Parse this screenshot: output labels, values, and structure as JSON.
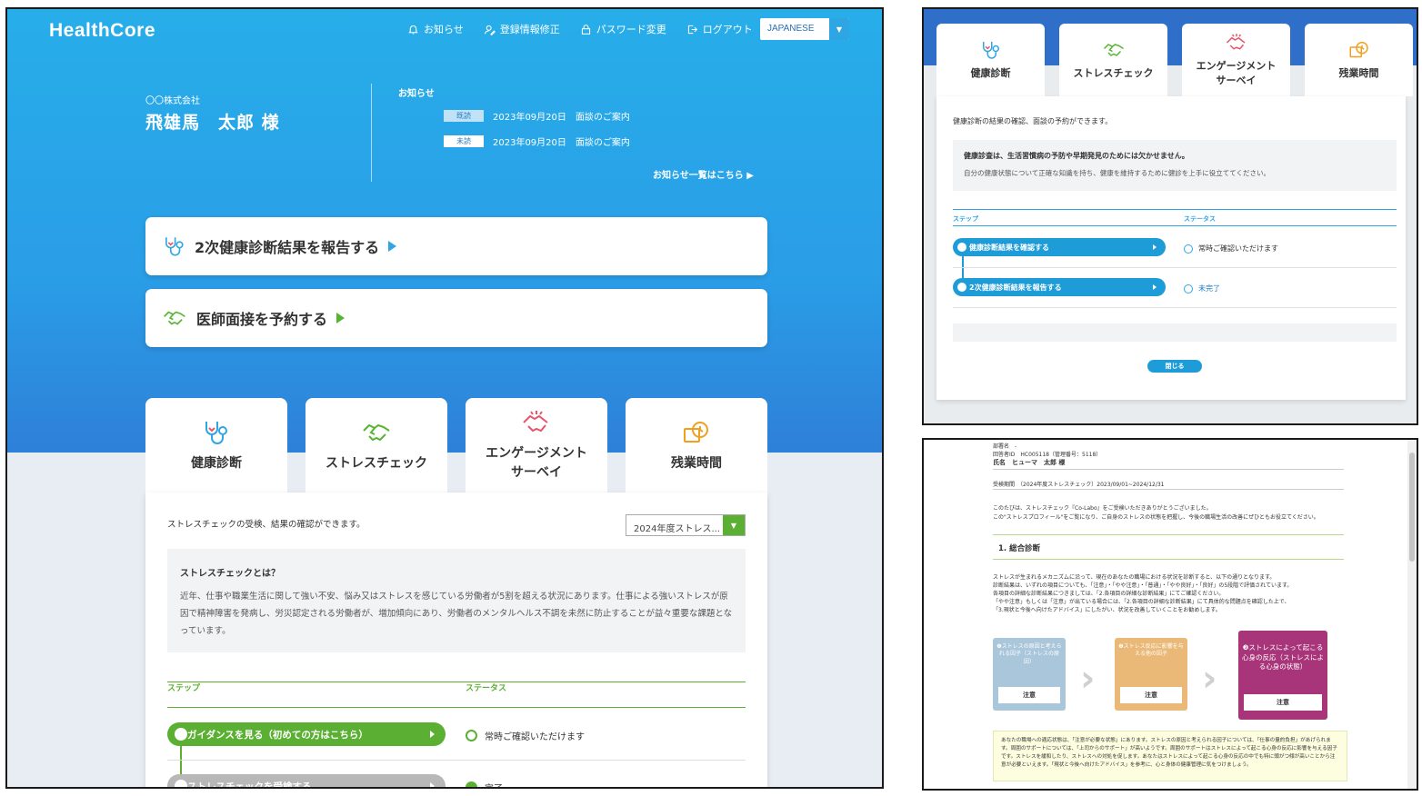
{
  "main": {
    "logo": "HealthCore",
    "nav": [
      "お知らせ",
      "登録情報修正",
      "パスワード変更",
      "ログアウト"
    ],
    "language": "JAPANESE",
    "company": "〇〇株式会社",
    "user_name": "飛雄馬　太郎 様",
    "notices": {
      "title": "お知らせ",
      "items": [
        {
          "badge": "既読",
          "date": "2023年09月20日",
          "text": "面談のご案内"
        },
        {
          "badge": "未読",
          "date": "2023年09月20日",
          "text": "面談のご案内"
        }
      ],
      "list_link": "お知らせ一覧はこちら ▶"
    },
    "action_report": "2次健康診断結果を報告する",
    "action_reserve": "医師面接を予約する",
    "tabs": [
      "健康診断",
      "ストレスチェック",
      "エンゲージメント\nサーベイ",
      "残業時間"
    ],
    "content": {
      "description": "ストレスチェックの受検、結果の確認ができます。",
      "year_select": "2024年度ストレス...",
      "info_title": "ストレスチェックとは？",
      "info_body": "近年、仕事や職業生活に関して強い不安、悩み又はストレスを感じている労働者が5割を超える状況にあります。仕事による強いストレスが原因で精神障害を発病し、労災認定される労働者が、増加傾向にあり、労働者のメンタルヘルス不調を未然に防止することが益々重要な課題となっています。",
      "col_step": "ステップ",
      "col_status": "ステータス",
      "steps": [
        {
          "label": "ガイダンスを見る（初めての方はこちら）",
          "status": "常時ご確認いただけます"
        },
        {
          "label": "ストレスチェックを受検する",
          "status": "完了"
        }
      ]
    }
  },
  "top_right": {
    "tabs": [
      "健康診断",
      "ストレスチェック",
      "エンゲージメント\nサーベイ",
      "残業時間"
    ],
    "description": "健康診断の結果の確認、面談の予約ができます。",
    "info_title": "健康診査は、生活習慣病の予防や早期発見のためには欠かせません。",
    "info_body": "自分の健康状態について正確な知識を持ち、健康を維持するために健診を上手に役立ててください。",
    "col_step": "ステップ",
    "col_status": "ステータス",
    "steps": [
      {
        "label": "健康診断結果を確認する",
        "status": "常時ご確認いただけます"
      },
      {
        "label": "2次健康診断結果を報告する",
        "status": "未完了"
      }
    ],
    "close": "閉じる"
  },
  "bottom_right": {
    "meta_label": "部署名",
    "meta_value": "-",
    "id_line": "回答者ID　HC005118（管理番号：5118）",
    "name_label": "氏名",
    "name_value": "ヒューマ　太郎 様",
    "period_label": "受検期間",
    "period_value": "（2024年度ストレスチェック）2023/09/01~2024/12/31",
    "intro1": "このたびは、ストレスチェック『Co-Labo』をご受検いただきありがとうございました。",
    "intro2": "この\"ストレスプロフィール\"をご覧になり、ご自身のストレスの状態を把握し、今後の職場生活の改善にぜひともお役立てください。",
    "section": "1. 総合診断",
    "body_lines": [
      "ストレスが生まれるメカニズムに沿って、現在のあなたの職場における状況を診断すると、以下の通りとなります。",
      "診断結果は、いずれの項目についても、「注意」・「やや注意」・「普通」・「やや良好」・「良好」の5段階で評価されています。",
      "各項目の詳細な診断結果につきましては、「2.各項目の詳細な診断結果」にてご確認ください。",
      "「やや注意」もしくは「注意」が出ている場合には、「2.各項目の詳細な診断結果」にて具体的な問題点を確認した上で、",
      "「3.現状と今後へ向けたアドバイス」にしたがい、状況を改善していくことをお勧めします。"
    ],
    "factors": [
      {
        "title": "❶ストレスの原因と考えられる因子（ストレスの原因）",
        "value": "注意"
      },
      {
        "title": "❷ストレス反応に影響を与える他の因子",
        "value": "注意"
      },
      {
        "title": "❸ストレスによって起こる心身の反応（ストレスによる心身の状態）",
        "value": "注意"
      }
    ],
    "summary": "あなたの職場への適応状態は、「注意が必要な状態」にあります。ストレスの原因と考えられる因子については、「仕事の量的負担」があげられます。周囲のサポートについては、「上司からのサポート」が高いようです。周囲のサポートはストレスによって起こる心身の反応に影響を与える因子です。ストレスを緩和したり、ストレスへの対処を促します。あなたはストレスによって起こる心身の反応の中でも特に頭がつ傾が高いことから注意が必要といえます。「現状と今後へ向けたアドバイス」を参考に、心と身体の健康管理に気をつけましょう。"
  }
}
